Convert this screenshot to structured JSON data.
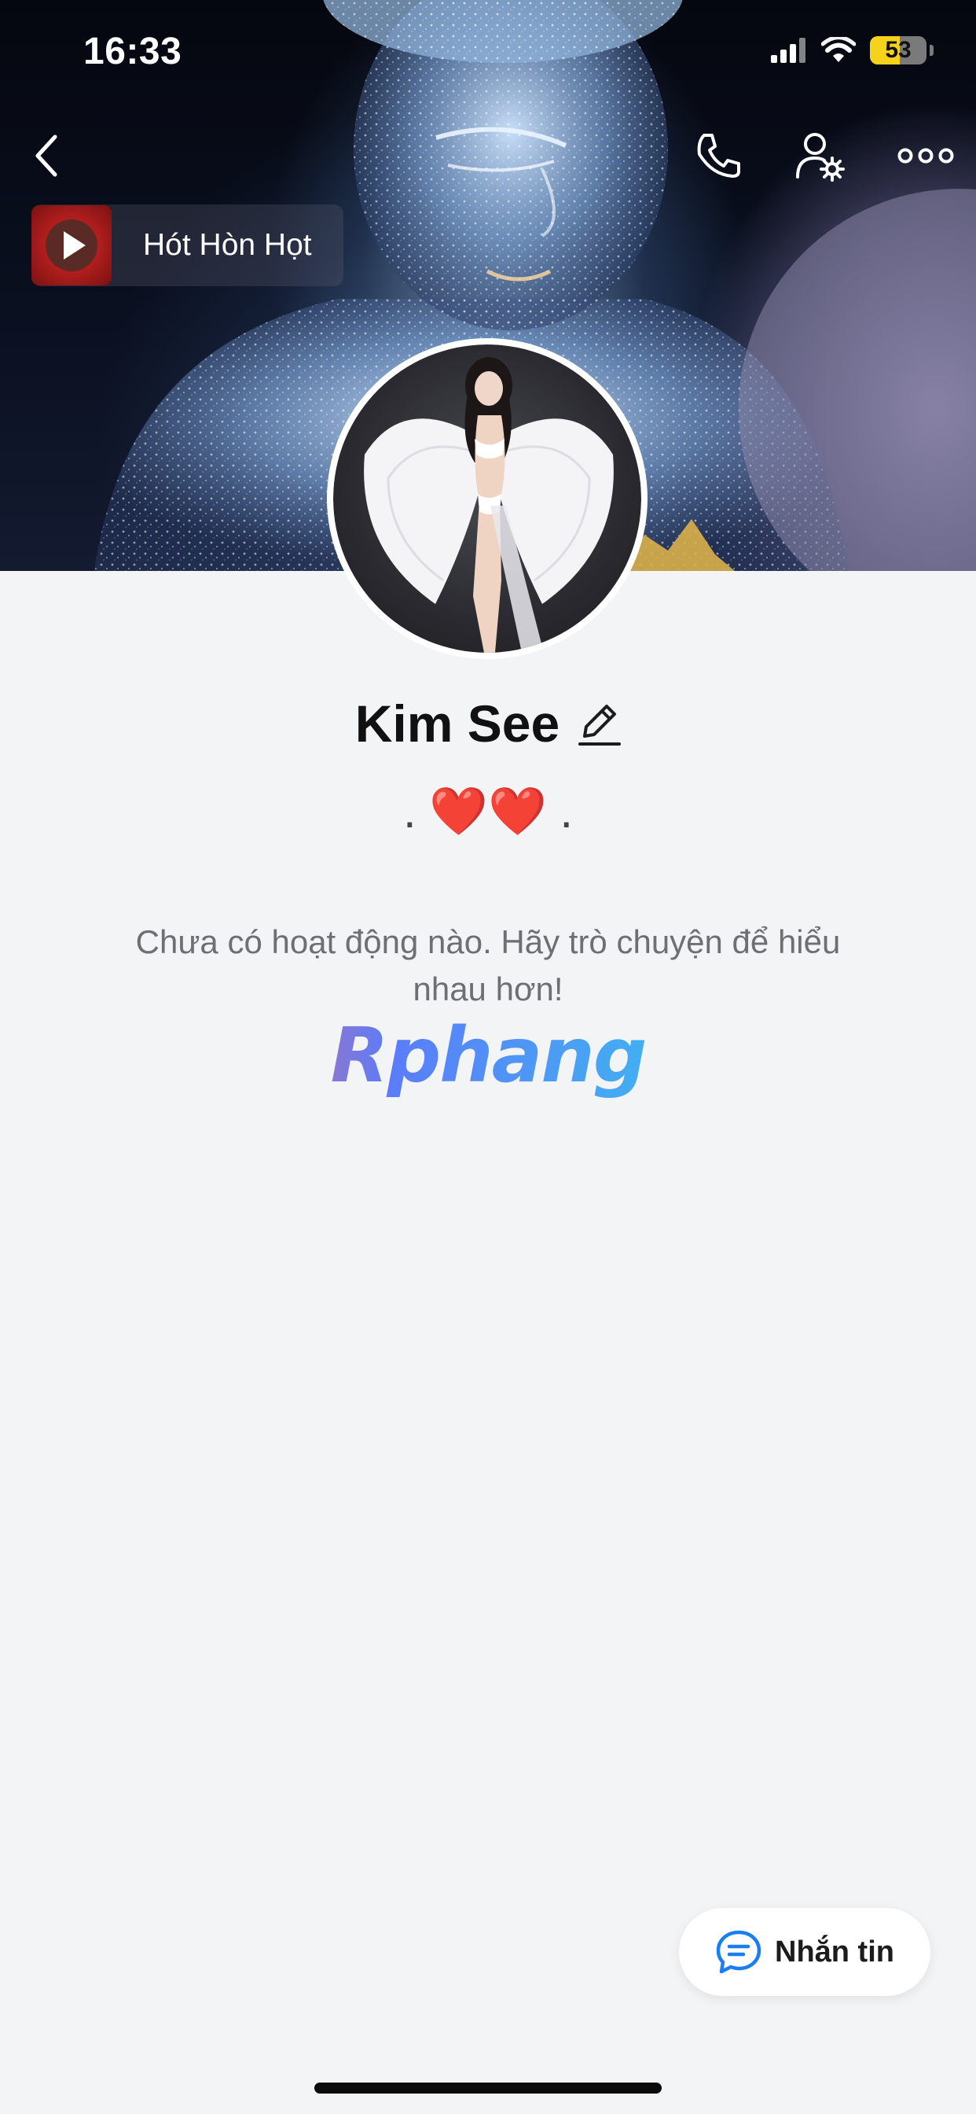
{
  "status_bar": {
    "time": "16:33",
    "battery": "53",
    "battery_level": 0.53
  },
  "header": {
    "back_icon": "chevron-left-icon",
    "call_icon": "phone-icon",
    "settings_icon": "user-settings-icon",
    "more_icon": "more-horizontal-icon"
  },
  "music": {
    "title": "Hót Hòn Họt",
    "icon": "play-icon"
  },
  "profile": {
    "name": "Kim See",
    "edit_icon": "pencil-icon",
    "bio_prefix": ". ",
    "bio_hearts": "❤️❤️",
    "bio_suffix": " ."
  },
  "activity": {
    "empty_message": "Chưa có hoạt động nào. Hãy trò chuyện để hiểu nhau hơn!"
  },
  "watermark": {
    "text": "Rphang"
  },
  "actions": {
    "message_label": "Nhắn tin",
    "message_icon": "chat-bubble-icon"
  },
  "colors": {
    "accent": "#1a7ef0",
    "background": "#f3f4f6",
    "battery": "#f7d21a",
    "heart": "#e0162b"
  }
}
